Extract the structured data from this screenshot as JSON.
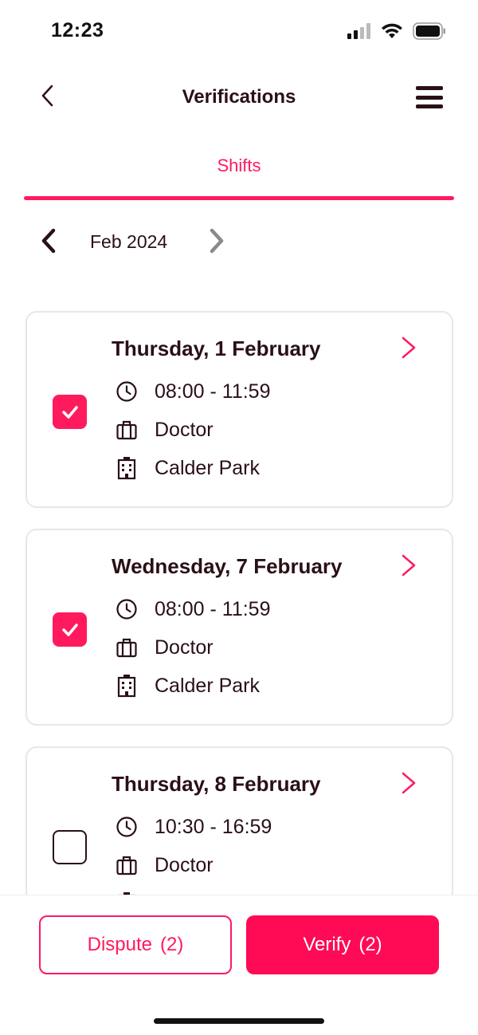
{
  "status_bar": {
    "time": "12:23"
  },
  "header": {
    "title": "Verifications",
    "back_icon": "chevron-left-icon",
    "menu_icon": "hamburger-menu-icon"
  },
  "tabs": [
    {
      "label": "Shifts",
      "active": true
    }
  ],
  "month_nav": {
    "label": "Feb 2024"
  },
  "shifts": [
    {
      "date": "Thursday, 1 February",
      "time": "08:00 - 11:59",
      "role": "Doctor",
      "location": "Calder Park",
      "checked": true
    },
    {
      "date": "Wednesday, 7 February",
      "time": "08:00 - 11:59",
      "role": "Doctor",
      "location": "Calder Park",
      "checked": true
    },
    {
      "date": "Thursday, 8 February",
      "time": "10:30 - 16:59",
      "role": "Doctor",
      "location": "",
      "checked": false
    }
  ],
  "actions": {
    "dispute_label": "Dispute",
    "dispute_count": "(2)",
    "verify_label": "Verify",
    "verify_count": "(2)"
  },
  "colors": {
    "accent": "#ff1a5e",
    "text": "#2a1016"
  }
}
